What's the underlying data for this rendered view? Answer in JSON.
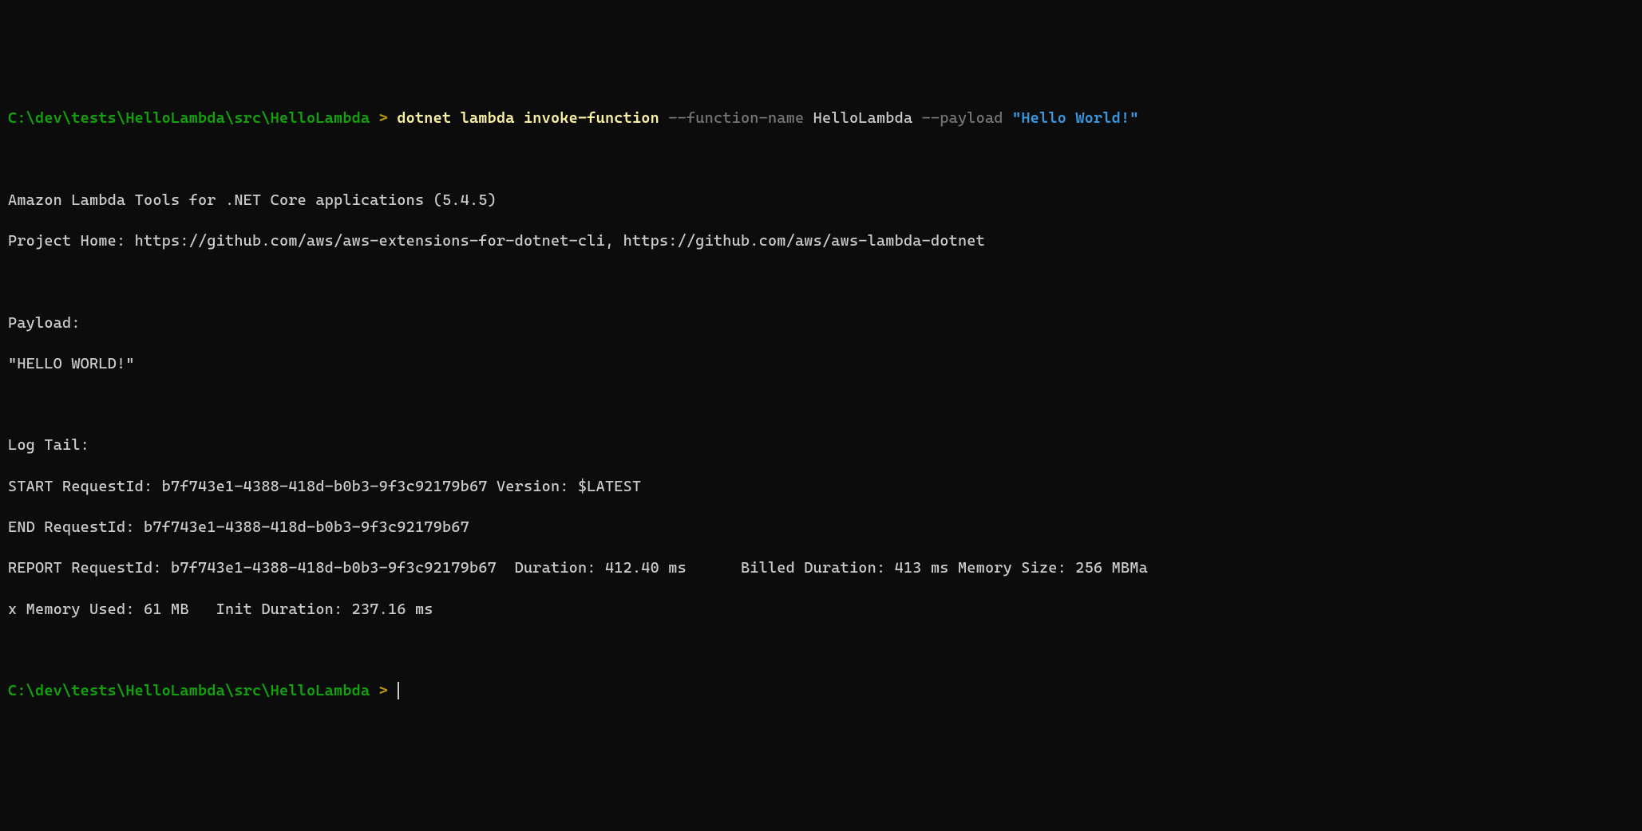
{
  "prompt1": {
    "path": "C:\\dev\\tests\\HelloLambda\\src\\HelloLambda",
    "sep": " > ",
    "cmd_main": "dotnet lambda invoke-function",
    "flag_fn": " --function-name ",
    "arg_fn": "HelloLambda",
    "flag_pl": " --payload ",
    "arg_pl": "\"Hello World!\""
  },
  "out": {
    "title_line": "Amazon Lambda Tools for .NET Core applications (5.4.5)",
    "home_line": "Project Home: https://github.com/aws/aws-extensions-for-dotnet-cli, https://github.com/aws/aws-lambda-dotnet",
    "payload_label": "Payload:",
    "payload_value": "\"HELLO WORLD!\"",
    "logtail_label": "Log Tail:",
    "log_start": "START RequestId: b7f743e1-4388-418d-b0b3-9f3c92179b67 Version: $LATEST",
    "log_end": "END RequestId: b7f743e1-4388-418d-b0b3-9f3c92179b67",
    "log_report1": "REPORT RequestId: b7f743e1-4388-418d-b0b3-9f3c92179b67  Duration: 412.40 ms      Billed Duration: 413 ms Memory Size: 256 MBMa",
    "log_report2": "x Memory Used: 61 MB   Init Duration: 237.16 ms"
  },
  "prompt2": {
    "path": "C:\\dev\\tests\\HelloLambda\\src\\HelloLambda",
    "sep": " > "
  }
}
